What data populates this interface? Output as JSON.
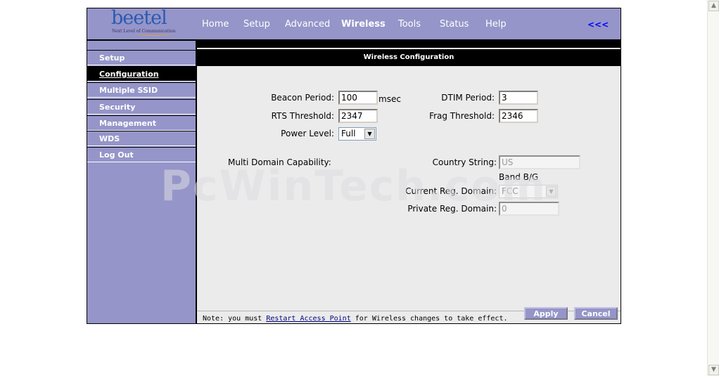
{
  "brand": {
    "logo": "beetel",
    "tagline": "Next Level of Communication"
  },
  "nav": {
    "items": [
      "Home",
      "Setup",
      "Advanced",
      "Wireless",
      "Tools",
      "Status",
      "Help"
    ],
    "active": "Wireless",
    "collapse": "<<<"
  },
  "sidebar": {
    "items": [
      "Setup",
      "Configuration",
      "Multiple SSID",
      "Security",
      "Management",
      "WDS",
      "Log Out"
    ],
    "active": "Configuration"
  },
  "content": {
    "title": "Wireless Configuration",
    "beacon_period": {
      "label": "Beacon Period:",
      "value": "100",
      "unit": "msec"
    },
    "dtim_period": {
      "label": "DTIM Period:",
      "value": "3"
    },
    "rts_threshold": {
      "label": "RTS Threshold:",
      "value": "2347"
    },
    "frag_threshold": {
      "label": "Frag Threshold:",
      "value": "2346"
    },
    "power_level": {
      "label": "Power Level:",
      "value": "Full"
    },
    "multi_domain": {
      "label": "Multi Domain Capability:"
    },
    "country_string": {
      "label": "Country String:",
      "value": "US"
    },
    "band_label": "Band B/G",
    "current_reg_domain": {
      "label": "Current Reg. Domain:",
      "value": "FCC"
    },
    "private_reg_domain": {
      "label": "Private Reg. Domain:",
      "value": "0"
    }
  },
  "footer": {
    "note_prefix": "Note: you must ",
    "note_link": "Restart Access Point",
    "note_suffix": " for Wireless changes to take effect.",
    "apply": "Apply",
    "cancel": "Cancel"
  },
  "watermark": "PcWinTech.com",
  "colors": {
    "header_bg": "#9595c9",
    "content_bg": "#ebebeb",
    "collapse_link": "#0000ff"
  }
}
